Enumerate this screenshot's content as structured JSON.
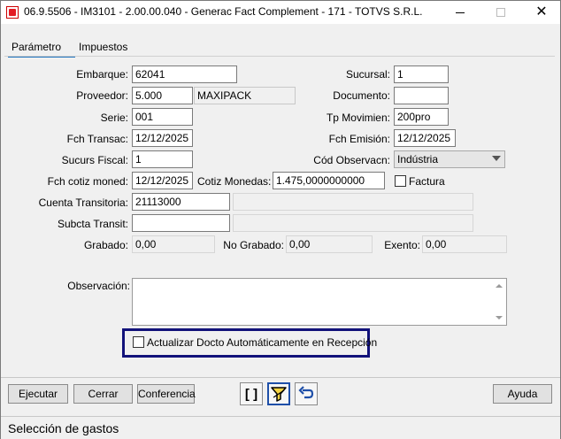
{
  "window": {
    "title": "06.9.5506 - IM3101 - 2.00.00.040 - Generac Fact Complement - 171 - TOTVS S.R.L."
  },
  "tabs": [
    {
      "label": "Parámetro",
      "active": true
    },
    {
      "label": "Impuestos",
      "active": false
    }
  ],
  "form": {
    "embarque": {
      "label": "Embarque:",
      "value": "62041"
    },
    "proveedor": {
      "label": "Proveedor:",
      "value": "5.000",
      "name": "MAXIPACK"
    },
    "serie": {
      "label": "Serie:",
      "value": "001"
    },
    "fch_transac": {
      "label": "Fch Transac:",
      "value": "12/12/2025"
    },
    "sucurs_fiscal": {
      "label": "Sucurs Fiscal:",
      "value": "1"
    },
    "fch_cotiz": {
      "label": "Fch cotiz moned:",
      "value": "12/12/2025"
    },
    "cotiz_monedas": {
      "label": "Cotiz Monedas:",
      "value": "1.475,0000000000"
    },
    "cuenta_transitoria": {
      "label": "Cuenta Transitoria:",
      "value": "21113000",
      "desc": ""
    },
    "subcta_transit": {
      "label": "Subcta Transit:",
      "value": "",
      "desc": ""
    },
    "sucursal": {
      "label": "Sucursal:",
      "value": "1"
    },
    "documento": {
      "label": "Documento:",
      "value": ""
    },
    "tp_movimien": {
      "label": "Tp Movimien:",
      "value": "200pro"
    },
    "fch_emision": {
      "label": "Fch Emisión:",
      "value": "12/12/2025"
    },
    "cod_observacn": {
      "label": "Cód Observacn:",
      "value": "Indústria"
    },
    "factura": {
      "label": "Factura",
      "checked": false
    },
    "grabado": {
      "label": "Grabado:",
      "value": "0,00"
    },
    "no_grabado": {
      "label": "No Grabado:",
      "value": "0,00"
    },
    "exento": {
      "label": "Exento:",
      "value": "0,00"
    },
    "observacion": {
      "label": "Observación:",
      "value": ""
    },
    "actualizar": {
      "label": "Actualizar Docto Automáticamente en Recepción",
      "checked": false
    }
  },
  "buttons": {
    "ejecutar": "Ejecutar",
    "cerrar": "Cerrar",
    "conferencia": "Conferencia",
    "brackets": "[ ]",
    "ayuda": "Ayuda"
  },
  "status": "Selección de gastos",
  "colors": {
    "highlight_border": "#12127a",
    "tab_underline": "#1e73be"
  }
}
